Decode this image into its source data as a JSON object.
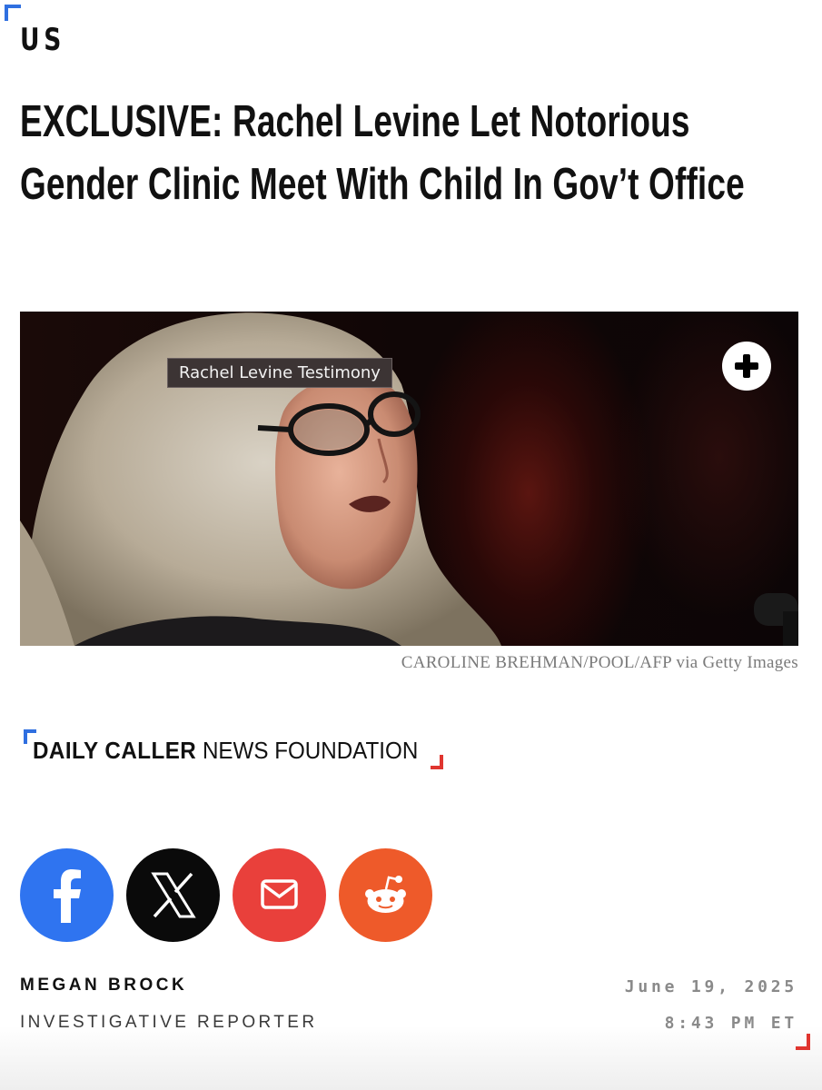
{
  "section": {
    "label": "US"
  },
  "article": {
    "headline": "EXCLUSIVE: Rachel Levine Let Notorious Gender Clinic Meet With Child In Gov’t Office",
    "image": {
      "tooltip": "Rachel Levine Testimony",
      "expand_icon": "plus-circle-icon",
      "credit": "CAROLINE BREHMAN/POOL/AFP via Getty Images"
    }
  },
  "brand": {
    "name_bold": "DAILY CALLER",
    "name_light": " NEWS FOUNDATION",
    "colors": {
      "blue": "#2f6fe0",
      "red": "#e0352f"
    }
  },
  "share": [
    {
      "network": "facebook",
      "icon": "facebook-icon",
      "color": "#2f74f0"
    },
    {
      "network": "x",
      "icon": "x-icon",
      "color": "#0a0a0a"
    },
    {
      "network": "email",
      "icon": "mail-icon",
      "color": "#e9403b"
    },
    {
      "network": "reddit",
      "icon": "reddit-icon",
      "color": "#ee5a2a"
    }
  ],
  "byline": {
    "author": "MEGAN BROCK",
    "role": "INVESTIGATIVE REPORTER",
    "date": "June 19, 2025",
    "time": "8:43 PM ET"
  }
}
